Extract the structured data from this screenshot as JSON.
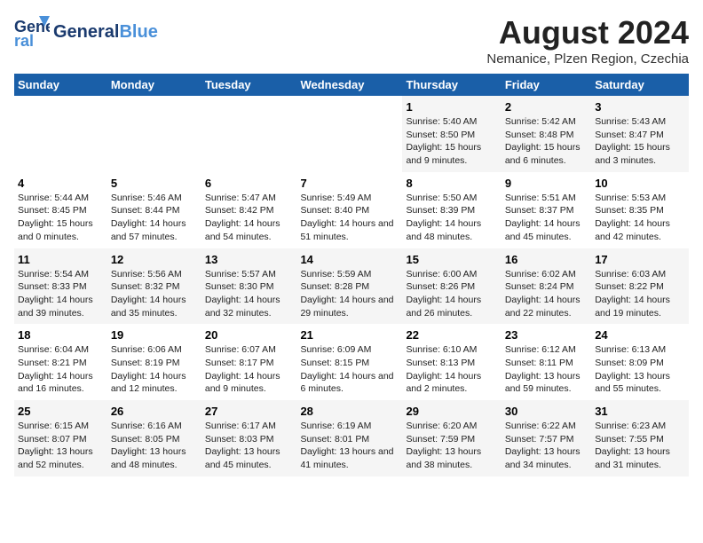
{
  "header": {
    "logo_general": "General",
    "logo_blue": "Blue",
    "title": "August 2024",
    "subtitle": "Nemanice, Plzen Region, Czechia"
  },
  "calendar": {
    "days_of_week": [
      "Sunday",
      "Monday",
      "Tuesday",
      "Wednesday",
      "Thursday",
      "Friday",
      "Saturday"
    ],
    "weeks": [
      [
        {
          "day": "",
          "info": ""
        },
        {
          "day": "",
          "info": ""
        },
        {
          "day": "",
          "info": ""
        },
        {
          "day": "",
          "info": ""
        },
        {
          "day": "1",
          "info": "Sunrise: 5:40 AM\nSunset: 8:50 PM\nDaylight: 15 hours and 9 minutes."
        },
        {
          "day": "2",
          "info": "Sunrise: 5:42 AM\nSunset: 8:48 PM\nDaylight: 15 hours and 6 minutes."
        },
        {
          "day": "3",
          "info": "Sunrise: 5:43 AM\nSunset: 8:47 PM\nDaylight: 15 hours and 3 minutes."
        }
      ],
      [
        {
          "day": "4",
          "info": "Sunrise: 5:44 AM\nSunset: 8:45 PM\nDaylight: 15 hours and 0 minutes."
        },
        {
          "day": "5",
          "info": "Sunrise: 5:46 AM\nSunset: 8:44 PM\nDaylight: 14 hours and 57 minutes."
        },
        {
          "day": "6",
          "info": "Sunrise: 5:47 AM\nSunset: 8:42 PM\nDaylight: 14 hours and 54 minutes."
        },
        {
          "day": "7",
          "info": "Sunrise: 5:49 AM\nSunset: 8:40 PM\nDaylight: 14 hours and 51 minutes."
        },
        {
          "day": "8",
          "info": "Sunrise: 5:50 AM\nSunset: 8:39 PM\nDaylight: 14 hours and 48 minutes."
        },
        {
          "day": "9",
          "info": "Sunrise: 5:51 AM\nSunset: 8:37 PM\nDaylight: 14 hours and 45 minutes."
        },
        {
          "day": "10",
          "info": "Sunrise: 5:53 AM\nSunset: 8:35 PM\nDaylight: 14 hours and 42 minutes."
        }
      ],
      [
        {
          "day": "11",
          "info": "Sunrise: 5:54 AM\nSunset: 8:33 PM\nDaylight: 14 hours and 39 minutes."
        },
        {
          "day": "12",
          "info": "Sunrise: 5:56 AM\nSunset: 8:32 PM\nDaylight: 14 hours and 35 minutes."
        },
        {
          "day": "13",
          "info": "Sunrise: 5:57 AM\nSunset: 8:30 PM\nDaylight: 14 hours and 32 minutes."
        },
        {
          "day": "14",
          "info": "Sunrise: 5:59 AM\nSunset: 8:28 PM\nDaylight: 14 hours and 29 minutes."
        },
        {
          "day": "15",
          "info": "Sunrise: 6:00 AM\nSunset: 8:26 PM\nDaylight: 14 hours and 26 minutes."
        },
        {
          "day": "16",
          "info": "Sunrise: 6:02 AM\nSunset: 8:24 PM\nDaylight: 14 hours and 22 minutes."
        },
        {
          "day": "17",
          "info": "Sunrise: 6:03 AM\nSunset: 8:22 PM\nDaylight: 14 hours and 19 minutes."
        }
      ],
      [
        {
          "day": "18",
          "info": "Sunrise: 6:04 AM\nSunset: 8:21 PM\nDaylight: 14 hours and 16 minutes."
        },
        {
          "day": "19",
          "info": "Sunrise: 6:06 AM\nSunset: 8:19 PM\nDaylight: 14 hours and 12 minutes."
        },
        {
          "day": "20",
          "info": "Sunrise: 6:07 AM\nSunset: 8:17 PM\nDaylight: 14 hours and 9 minutes."
        },
        {
          "day": "21",
          "info": "Sunrise: 6:09 AM\nSunset: 8:15 PM\nDaylight: 14 hours and 6 minutes."
        },
        {
          "day": "22",
          "info": "Sunrise: 6:10 AM\nSunset: 8:13 PM\nDaylight: 14 hours and 2 minutes."
        },
        {
          "day": "23",
          "info": "Sunrise: 6:12 AM\nSunset: 8:11 PM\nDaylight: 13 hours and 59 minutes."
        },
        {
          "day": "24",
          "info": "Sunrise: 6:13 AM\nSunset: 8:09 PM\nDaylight: 13 hours and 55 minutes."
        }
      ],
      [
        {
          "day": "25",
          "info": "Sunrise: 6:15 AM\nSunset: 8:07 PM\nDaylight: 13 hours and 52 minutes."
        },
        {
          "day": "26",
          "info": "Sunrise: 6:16 AM\nSunset: 8:05 PM\nDaylight: 13 hours and 48 minutes."
        },
        {
          "day": "27",
          "info": "Sunrise: 6:17 AM\nSunset: 8:03 PM\nDaylight: 13 hours and 45 minutes."
        },
        {
          "day": "28",
          "info": "Sunrise: 6:19 AM\nSunset: 8:01 PM\nDaylight: 13 hours and 41 minutes."
        },
        {
          "day": "29",
          "info": "Sunrise: 6:20 AM\nSunset: 7:59 PM\nDaylight: 13 hours and 38 minutes."
        },
        {
          "day": "30",
          "info": "Sunrise: 6:22 AM\nSunset: 7:57 PM\nDaylight: 13 hours and 34 minutes."
        },
        {
          "day": "31",
          "info": "Sunrise: 6:23 AM\nSunset: 7:55 PM\nDaylight: 13 hours and 31 minutes."
        }
      ]
    ]
  }
}
